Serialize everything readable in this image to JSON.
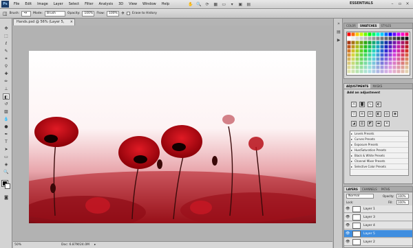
{
  "app": {
    "logo": "Ps",
    "workspace": "ESSENTIALS"
  },
  "menu": [
    "File",
    "Edit",
    "Image",
    "Layer",
    "Select",
    "Filter",
    "Analysis",
    "3D",
    "View",
    "Window",
    "Help"
  ],
  "toolbar_icons": [
    "hand-icon",
    "zoom-icon",
    "rotate-icon",
    "grid-icon",
    "ruler-icon",
    "zoom-level-icon",
    "view-icon",
    "layout-icon"
  ],
  "options": {
    "brush_label": "Brush:",
    "mode_label": "Mode:",
    "mode_value": "Brush",
    "opacity_label": "Opacity:",
    "opacity_value": "100%",
    "flow_label": "Flow:",
    "flow_value": "100%",
    "erase_history": "Erase to History"
  },
  "document": {
    "tab_title": "Hands.psd @ 56% (Layer 5, RGB/8)",
    "close": "×"
  },
  "status": {
    "zoom": "50%",
    "doc": "Doc: 6.87M/24.0M"
  },
  "panels": {
    "color_tabs": [
      "COLOR",
      "SWATCHES",
      "STYLES"
    ],
    "adjust_tabs": [
      "ADJUSTMENTS",
      "MASKS"
    ],
    "add_adjustment": "Add an adjustment",
    "presets": [
      "Levels Presets",
      "Curves Presets",
      "Exposure Presets",
      "Hue/Saturation Presets",
      "Black & White Presets",
      "Channel Mixer Presets",
      "Selective Color Presets"
    ],
    "layer_tabs": [
      "LAYERS",
      "CHANNELS",
      "PATHS"
    ],
    "blend_mode": "Normal",
    "opacity_label": "Opacity:",
    "opacity_value": "100%",
    "lock_label": "Lock:",
    "fill_label": "Fill:",
    "fill_value": "100%",
    "layers": [
      {
        "name": "Layer 1",
        "selected": false
      },
      {
        "name": "Layer 3",
        "selected": false
      },
      {
        "name": "Layer 4",
        "selected": false
      },
      {
        "name": "Layer 5",
        "selected": true
      },
      {
        "name": "Layer 2",
        "selected": false
      }
    ]
  },
  "colors": {
    "accent": "#3f8ee0",
    "poppy": "#c0101a",
    "poppy_dark": "#7a0008"
  }
}
